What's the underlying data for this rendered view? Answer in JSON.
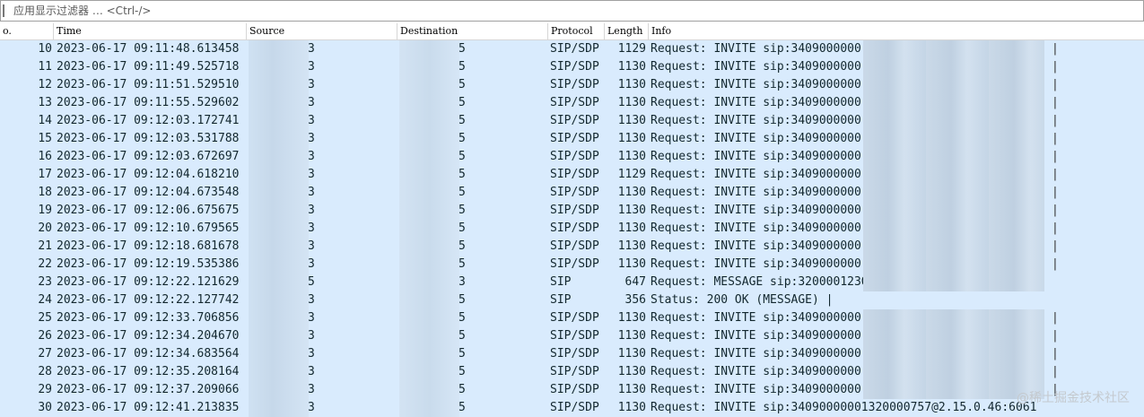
{
  "filter": {
    "placeholder": "应用显示过滤器 … <Ctrl-/>"
  },
  "columns": {
    "no": "o.",
    "time": "Time",
    "source": "Source",
    "destination": "Destination",
    "protocol": "Protocol",
    "length": "Length",
    "info": "Info"
  },
  "rows": [
    {
      "no": "10",
      "time": "2023-06-17 09:11:48.613458",
      "src": "3",
      "dst": "5",
      "proto": "SIP/SDP",
      "len": "1129",
      "info": "Request: INVITE sip:3409000000",
      "tail": "|"
    },
    {
      "no": "11",
      "time": "2023-06-17 09:11:49.525718",
      "src": "3",
      "dst": "5",
      "proto": "SIP/SDP",
      "len": "1130",
      "info": "Request: INVITE sip:3409000000",
      "tail": "|"
    },
    {
      "no": "12",
      "time": "2023-06-17 09:11:51.529510",
      "src": "3",
      "dst": "5",
      "proto": "SIP/SDP",
      "len": "1130",
      "info": "Request: INVITE sip:3409000000",
      "tail": "|"
    },
    {
      "no": "13",
      "time": "2023-06-17 09:11:55.529602",
      "src": "3",
      "dst": "5",
      "proto": "SIP/SDP",
      "len": "1130",
      "info": "Request: INVITE sip:3409000000",
      "tail": "|"
    },
    {
      "no": "14",
      "time": "2023-06-17 09:12:03.172741",
      "src": "3",
      "dst": "5",
      "proto": "SIP/SDP",
      "len": "1130",
      "info": "Request: INVITE sip:3409000000",
      "tail": "|"
    },
    {
      "no": "15",
      "time": "2023-06-17 09:12:03.531788",
      "src": "3",
      "dst": "5",
      "proto": "SIP/SDP",
      "len": "1130",
      "info": "Request: INVITE sip:3409000000",
      "tail": "|"
    },
    {
      "no": "16",
      "time": "2023-06-17 09:12:03.672697",
      "src": "3",
      "dst": "5",
      "proto": "SIP/SDP",
      "len": "1130",
      "info": "Request: INVITE sip:3409000000",
      "tail": "|"
    },
    {
      "no": "17",
      "time": "2023-06-17 09:12:04.618210",
      "src": "3",
      "dst": "5",
      "proto": "SIP/SDP",
      "len": "1129",
      "info": "Request: INVITE sip:3409000000",
      "tail": "|"
    },
    {
      "no": "18",
      "time": "2023-06-17 09:12:04.673548",
      "src": "3",
      "dst": "5",
      "proto": "SIP/SDP",
      "len": "1130",
      "info": "Request: INVITE sip:3409000000",
      "tail": "|"
    },
    {
      "no": "19",
      "time": "2023-06-17 09:12:06.675675",
      "src": "3",
      "dst": "5",
      "proto": "SIP/SDP",
      "len": "1130",
      "info": "Request: INVITE sip:3409000000",
      "tail": "|"
    },
    {
      "no": "20",
      "time": "2023-06-17 09:12:10.679565",
      "src": "3",
      "dst": "5",
      "proto": "SIP/SDP",
      "len": "1130",
      "info": "Request: INVITE sip:3409000000",
      "tail": "|"
    },
    {
      "no": "21",
      "time": "2023-06-17 09:12:18.681678",
      "src": "3",
      "dst": "5",
      "proto": "SIP/SDP",
      "len": "1130",
      "info": "Request: INVITE sip:3409000000",
      "tail": "|"
    },
    {
      "no": "22",
      "time": "2023-06-17 09:12:19.535386",
      "src": "3",
      "dst": "5",
      "proto": "SIP/SDP",
      "len": "1130",
      "info": "Request: INVITE sip:3409000000",
      "tail": "|"
    },
    {
      "no": "23",
      "time": "2023-06-17 09:12:22.121629",
      "src": "5",
      "dst": "3",
      "proto": "SIP",
      "len": "647",
      "info": "Request: MESSAGE sip:3200001230",
      "tail": ""
    },
    {
      "no": "24",
      "time": "2023-06-17 09:12:22.127742",
      "src": "3",
      "dst": "5",
      "proto": "SIP",
      "len": "356",
      "info": "Status: 200 OK (MESSAGE) |",
      "tail": ""
    },
    {
      "no": "25",
      "time": "2023-06-17 09:12:33.706856",
      "src": "3",
      "dst": "5",
      "proto": "SIP/SDP",
      "len": "1130",
      "info": "Request: INVITE sip:3409000000",
      "tail": "|"
    },
    {
      "no": "26",
      "time": "2023-06-17 09:12:34.204670",
      "src": "3",
      "dst": "5",
      "proto": "SIP/SDP",
      "len": "1130",
      "info": "Request: INVITE sip:3409000000",
      "tail": "|"
    },
    {
      "no": "27",
      "time": "2023-06-17 09:12:34.683564",
      "src": "3",
      "dst": "5",
      "proto": "SIP/SDP",
      "len": "1130",
      "info": "Request: INVITE sip:3409000000",
      "tail": "|"
    },
    {
      "no": "28",
      "time": "2023-06-17 09:12:35.208164",
      "src": "3",
      "dst": "5",
      "proto": "SIP/SDP",
      "len": "1130",
      "info": "Request: INVITE sip:3409000000",
      "tail": "|"
    },
    {
      "no": "29",
      "time": "2023-06-17 09:12:37.209066",
      "src": "3",
      "dst": "5",
      "proto": "SIP/SDP",
      "len": "1130",
      "info": "Request: INVITE sip:3409000000",
      "tail": "|"
    },
    {
      "no": "30",
      "time": "2023-06-17 09:12:41.213835",
      "src": "3",
      "dst": "5",
      "proto": "SIP/SDP",
      "len": "1130",
      "info": "Request: INVITE sip:34090000001320000757@2.15.0.46:6061",
      "tail": ""
    }
  ],
  "redacted_rows": [
    true,
    true,
    true,
    true,
    true,
    true,
    true,
    true,
    true,
    true,
    true,
    true,
    true,
    true,
    false,
    true,
    true,
    true,
    true,
    true,
    false
  ],
  "watermark": "@稀土掘金技术社区",
  "colors": {
    "row_bg": "#d9ebfd",
    "header_bg": "#ffffff",
    "text": "#12272e"
  }
}
